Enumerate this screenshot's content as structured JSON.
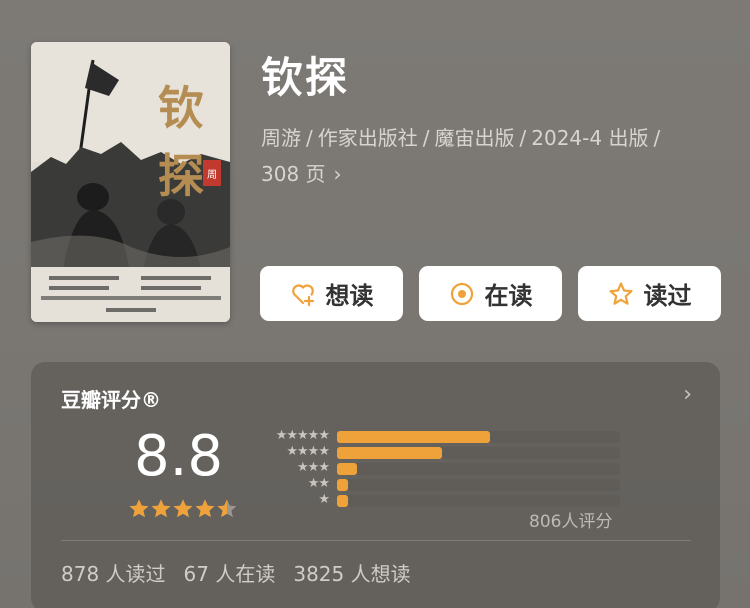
{
  "book": {
    "title": "钦探",
    "meta_line1": [
      "周游",
      "作家出版社",
      "魔宙出版",
      "2024-4 出版"
    ],
    "meta_line2": "308 页",
    "cover_title": "钦探",
    "cover_author": "周游",
    "cover_publisher": "作家出版社"
  },
  "actions": {
    "want": "想读",
    "reading": "在读",
    "read": "读过"
  },
  "rating": {
    "title": "豆瓣评分®",
    "score": "8.8",
    "stars": 4.5,
    "count_label": "806人评分",
    "distribution": [
      {
        "stars": "★★★★★",
        "fraction": 0.54
      },
      {
        "stars": "★★★★",
        "fraction": 0.37
      },
      {
        "stars": "★★★",
        "fraction": 0.07
      },
      {
        "stars": "★★",
        "fraction": 0.04
      },
      {
        "stars": "★",
        "fraction": 0.04
      }
    ],
    "stats": [
      "878 人读过",
      "67 人在读",
      "3825 人想读"
    ]
  },
  "colors": {
    "accent": "#f0a23a",
    "star": "#f0a23a"
  }
}
